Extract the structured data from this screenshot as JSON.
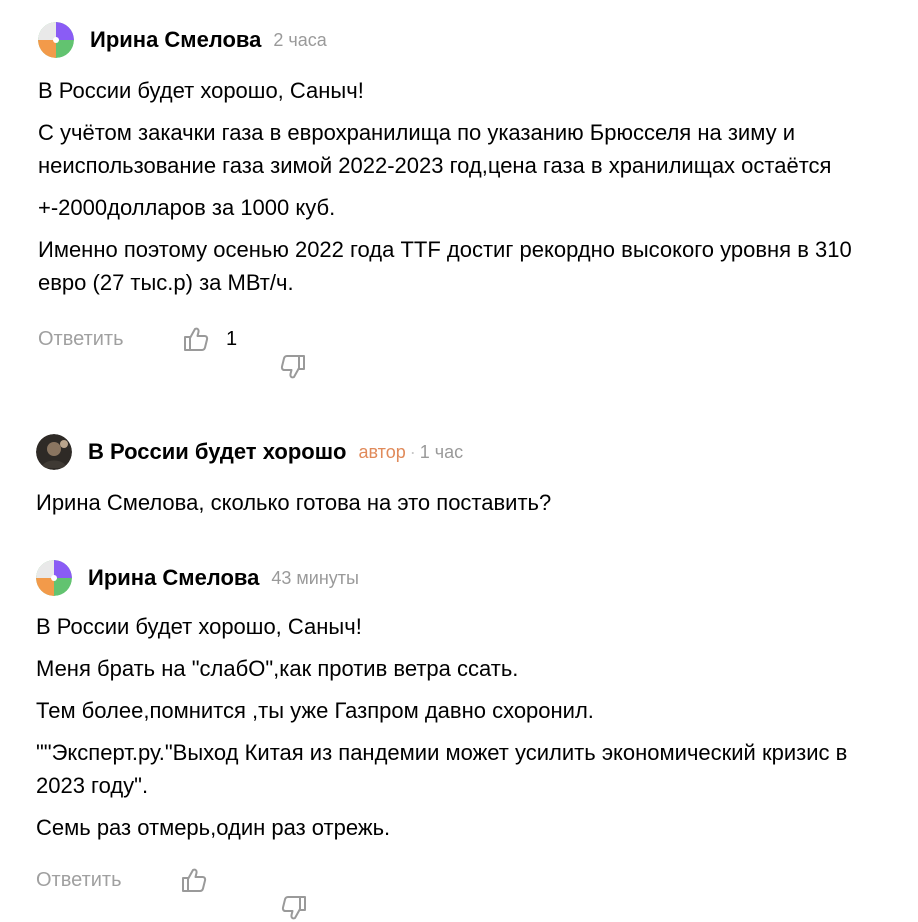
{
  "comments": [
    {
      "author": "Ирина Смелова",
      "time": "2 часа",
      "paragraphs": [
        "В России будет хорошо, Саныч!",
        "С учётом закачки газа в еврохранилища по указанию Брюсселя на зиму и неиспользование газа зимой 2022-2023 год,цена газа в хранилищах остаётся",
        "+-2000долларов за 1000 куб.",
        "Именно поэтому осенью 2022 года TTF достиг рекордно высокого уровня в 310 евро (27 тыс.р) за МВт/ч."
      ],
      "reply_label": "Ответить",
      "likes": "1"
    },
    {
      "author": "В России будет хорошо",
      "author_tag": "автор",
      "separator": "·",
      "time": "1 час",
      "paragraphs": [
        "Ирина Смелова, сколько готова на это поставить?"
      ]
    },
    {
      "author": "Ирина Смелова",
      "time": "43 минуты",
      "paragraphs": [
        "В России будет хорошо, Саныч!",
        "Меня брать на \"слабО\",как против ветра ссать.",
        "Тем более,помнится ,ты уже Газпром давно схоронил.",
        "\"\"Эксперт.ру.\"Выход Китая из пандемии может усилить экономический кризис в 2023 году\".",
        "Семь раз отмерь,один раз отрежь."
      ],
      "reply_label": "Ответить"
    }
  ],
  "colors": {
    "avatar_purple": "#8a5cf5",
    "avatar_green": "#62c370",
    "avatar_orange": "#f29a4a",
    "author_tag": "#e08a5a",
    "meta_gray": "#9a9a9a"
  },
  "icons": [
    "thumbs-up-icon",
    "thumbs-down-icon"
  ]
}
